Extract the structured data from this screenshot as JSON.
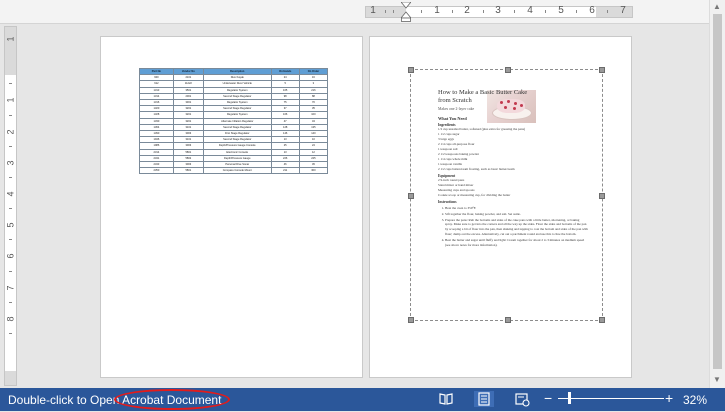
{
  "ruler": {
    "horizontal_numbers": [
      "1",
      "1",
      "2",
      "3",
      "4",
      "5",
      "6",
      "7"
    ],
    "vertical_numbers": [
      "1",
      "1",
      "2",
      "3",
      "4",
      "5",
      "6",
      "7",
      "8"
    ]
  },
  "page1": {
    "table": {
      "headers": [
        "Part No",
        "Vendor No",
        "Description",
        "On Hands",
        "On Order"
      ],
      "rows": [
        [
          "900",
          "2101",
          "Dive Kayak",
          "24",
          "16"
        ],
        [
          "912",
          "11222",
          "Underwater Diver Vehicle",
          "5",
          "3"
        ],
        [
          "1313",
          "3501",
          "Regulator System",
          "165",
          "216"
        ],
        [
          "1314",
          "2001",
          "Second Stage Regulator",
          "98",
          "88"
        ],
        [
          "1316",
          "3301",
          "Regulator System",
          "75",
          "70"
        ],
        [
          "1320",
          "3201",
          "Second Stage Regulator",
          "37",
          "35"
        ],
        [
          "1328",
          "3201",
          "Regulator System",
          "166",
          "100"
        ],
        [
          "1330",
          "3201",
          "Alternate Inflation Regulator",
          "47",
          "43"
        ],
        [
          "1364",
          "3101",
          "Second Stage Regulator",
          "128",
          "135"
        ],
        [
          "1390",
          "3003",
          "First Stage Regulator",
          "146",
          "140"
        ],
        [
          "1946",
          "3101",
          "Second Stage Regulator",
          "13",
          "10"
        ],
        [
          "1986",
          "3003",
          "Depth/Pressure Gauge Console",
          "25",
          "24"
        ],
        [
          "2314",
          "5801",
          "Electronic Console",
          "13",
          "12"
        ],
        [
          "2341",
          "5802",
          "Depth/Pressure Gauge",
          "226",
          "225"
        ],
        [
          "2343",
          "3003",
          "Personal Dive Sonar",
          "46",
          "45"
        ],
        [
          "2350",
          "5801",
          "Compass Console Mount",
          "211",
          "300"
        ]
      ]
    }
  },
  "page2": {
    "recipe": {
      "title": "How to Make a Basic Butter Cake from Scratch",
      "subtitle": "Makes one 2-layer cake",
      "what_you_need": "What You Need",
      "ingredients_heading": "Ingredients",
      "ingredients": [
        "1/2 cup unsalted butter, softened (plus extra for greasing the pans)",
        "1 1/2 cups sugar",
        "3 large eggs",
        "2 1/4 cups all-purpose flour",
        "1 teaspoon salt",
        "2 1/2 teaspoons baking powder",
        "1 1/4 cups whole milk",
        "1 teaspoon vanilla",
        "2 1/2 cups buttercream frosting, such as basic buttercream"
      ],
      "equipment_heading": "Equipment",
      "equipment": [
        "2 9-inch round pans",
        "Stand mixer or hand mixer",
        "Measuring cups and spoons",
        "Cookie scoop or measuring cup, for dividing the batter"
      ],
      "instructions_heading": "Instructions",
      "steps": [
        "Heat the oven to 350°F.",
        "Sift together the flour, baking powder, and salt. Set aside.",
        "Prepare the pans: Rub the bottoms and sides of the cake pans with a little butter, shortening, or baking spray. Make sure to get into the corners and all the way up the sides. Flour the sides and bottoms of the pan by scooping a bit of flour into the pan, then shaking and tapping to coat the bottom and sides of the pan with flour; dump out the excess. Alternatively, cut out a parchment round and use this to line the bottom.",
        "Beat the butter and sugar until fluffy and light: Cream together for about 2 to 3 minutes on medium speed (see above notes for more information)."
      ]
    }
  },
  "status": {
    "message": "Double-click to Open Acrobat Document",
    "zoom_minus": "−",
    "zoom_plus": "+",
    "zoom": "32%",
    "zoom_level_percent": 32,
    "annotation_color": "#e31b1b",
    "bar_color": "#2b579a"
  },
  "icons": {
    "read_mode": "book-icon",
    "print_layout": "print-layout-icon",
    "web_layout": "web-layout-icon"
  }
}
